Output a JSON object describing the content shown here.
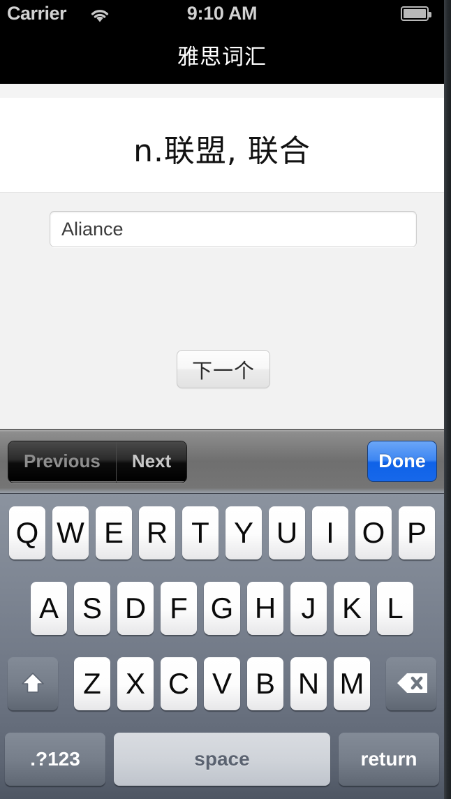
{
  "status_bar": {
    "carrier": "Carrier",
    "wifi_icon": "wifi-icon",
    "time": "9:10 AM",
    "battery_icon": "battery-icon"
  },
  "nav_bar": {
    "title": "雅思词汇"
  },
  "content": {
    "word_meaning": "n.联盟, 联合",
    "answer_input": {
      "value": "Aliance",
      "placeholder": ""
    },
    "next_button": "下一个"
  },
  "accessory_bar": {
    "previous_label": "Previous",
    "next_label": "Next",
    "done_label": "Done",
    "done_color": "#1768ea"
  },
  "keyboard": {
    "row1": [
      "Q",
      "W",
      "E",
      "R",
      "T",
      "Y",
      "U",
      "I",
      "O",
      "P"
    ],
    "row2": [
      "A",
      "S",
      "D",
      "F",
      "G",
      "H",
      "J",
      "K",
      "L"
    ],
    "row3": [
      "Z",
      "X",
      "C",
      "V",
      "B",
      "N",
      "M"
    ],
    "shift_icon": "shift-icon",
    "delete_icon": "delete-icon",
    "numbers_label": ".?123",
    "space_label": "space",
    "return_label": "return"
  }
}
